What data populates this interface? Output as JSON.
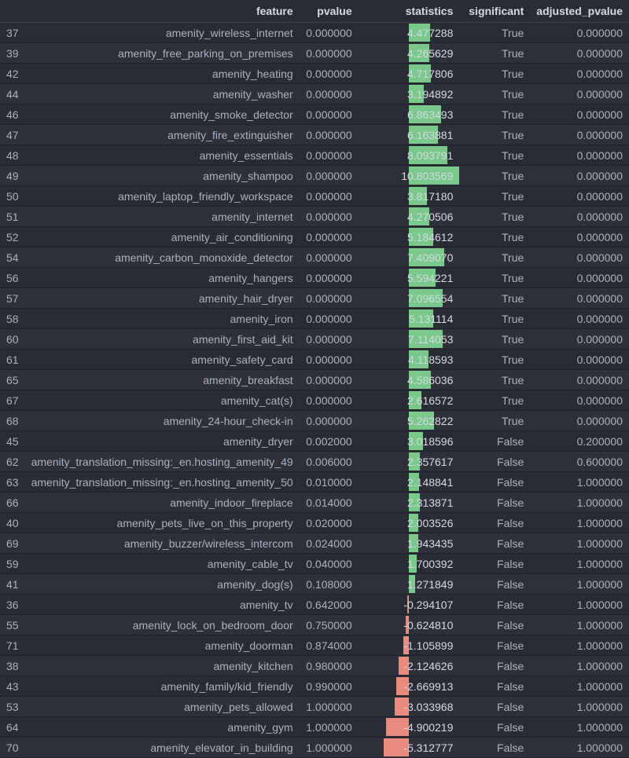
{
  "columns": {
    "idx": "",
    "feature": "feature",
    "pvalue": "pvalue",
    "statistics": "statistics",
    "significant": "significant",
    "adjusted_pvalue": "adjusted_pvalue"
  },
  "chart_data": {
    "type": "table",
    "title": "",
    "stat_range": [
      -10.803569,
      10.803569
    ],
    "rows": [
      {
        "idx": 37,
        "feature": "amenity_wireless_internet",
        "pvalue": "0.000000",
        "statistics": 4.477288,
        "significant": "True",
        "adjusted_pvalue": "0.000000"
      },
      {
        "idx": 39,
        "feature": "amenity_free_parking_on_premises",
        "pvalue": "0.000000",
        "statistics": 4.265629,
        "significant": "True",
        "adjusted_pvalue": "0.000000"
      },
      {
        "idx": 42,
        "feature": "amenity_heating",
        "pvalue": "0.000000",
        "statistics": 4.717806,
        "significant": "True",
        "adjusted_pvalue": "0.000000"
      },
      {
        "idx": 44,
        "feature": "amenity_washer",
        "pvalue": "0.000000",
        "statistics": 3.194892,
        "significant": "True",
        "adjusted_pvalue": "0.000000"
      },
      {
        "idx": 46,
        "feature": "amenity_smoke_detector",
        "pvalue": "0.000000",
        "statistics": 6.863493,
        "significant": "True",
        "adjusted_pvalue": "0.000000"
      },
      {
        "idx": 47,
        "feature": "amenity_fire_extinguisher",
        "pvalue": "0.000000",
        "statistics": 6.163881,
        "significant": "True",
        "adjusted_pvalue": "0.000000"
      },
      {
        "idx": 48,
        "feature": "amenity_essentials",
        "pvalue": "0.000000",
        "statistics": 8.093791,
        "significant": "True",
        "adjusted_pvalue": "0.000000"
      },
      {
        "idx": 49,
        "feature": "amenity_shampoo",
        "pvalue": "0.000000",
        "statistics": 10.803569,
        "significant": "True",
        "adjusted_pvalue": "0.000000"
      },
      {
        "idx": 50,
        "feature": "amenity_laptop_friendly_workspace",
        "pvalue": "0.000000",
        "statistics": 3.81718,
        "significant": "True",
        "adjusted_pvalue": "0.000000"
      },
      {
        "idx": 51,
        "feature": "amenity_internet",
        "pvalue": "0.000000",
        "statistics": 4.270506,
        "significant": "True",
        "adjusted_pvalue": "0.000000"
      },
      {
        "idx": 52,
        "feature": "amenity_air_conditioning",
        "pvalue": "0.000000",
        "statistics": 5.184612,
        "significant": "True",
        "adjusted_pvalue": "0.000000"
      },
      {
        "idx": 54,
        "feature": "amenity_carbon_monoxide_detector",
        "pvalue": "0.000000",
        "statistics": 7.40907,
        "significant": "True",
        "adjusted_pvalue": "0.000000"
      },
      {
        "idx": 56,
        "feature": "amenity_hangers",
        "pvalue": "0.000000",
        "statistics": 5.594221,
        "significant": "True",
        "adjusted_pvalue": "0.000000"
      },
      {
        "idx": 57,
        "feature": "amenity_hair_dryer",
        "pvalue": "0.000000",
        "statistics": 7.096554,
        "significant": "True",
        "adjusted_pvalue": "0.000000"
      },
      {
        "idx": 58,
        "feature": "amenity_iron",
        "pvalue": "0.000000",
        "statistics": 5.131114,
        "significant": "True",
        "adjusted_pvalue": "0.000000"
      },
      {
        "idx": 60,
        "feature": "amenity_first_aid_kit",
        "pvalue": "0.000000",
        "statistics": 7.114053,
        "significant": "True",
        "adjusted_pvalue": "0.000000"
      },
      {
        "idx": 61,
        "feature": "amenity_safety_card",
        "pvalue": "0.000000",
        "statistics": 4.118593,
        "significant": "True",
        "adjusted_pvalue": "0.000000"
      },
      {
        "idx": 65,
        "feature": "amenity_breakfast",
        "pvalue": "0.000000",
        "statistics": 4.586036,
        "significant": "True",
        "adjusted_pvalue": "0.000000"
      },
      {
        "idx": 67,
        "feature": "amenity_cat(s)",
        "pvalue": "0.000000",
        "statistics": 2.616572,
        "significant": "True",
        "adjusted_pvalue": "0.000000"
      },
      {
        "idx": 68,
        "feature": "amenity_24-hour_check-in",
        "pvalue": "0.000000",
        "statistics": 5.262822,
        "significant": "True",
        "adjusted_pvalue": "0.000000"
      },
      {
        "idx": 45,
        "feature": "amenity_dryer",
        "pvalue": "0.002000",
        "statistics": 3.018596,
        "significant": "False",
        "adjusted_pvalue": "0.200000"
      },
      {
        "idx": 62,
        "feature": "amenity_translation_missing:_en.hosting_amenity_49",
        "pvalue": "0.006000",
        "statistics": 2.357617,
        "significant": "False",
        "adjusted_pvalue": "0.600000"
      },
      {
        "idx": 63,
        "feature": "amenity_translation_missing:_en.hosting_amenity_50",
        "pvalue": "0.010000",
        "statistics": 2.148841,
        "significant": "False",
        "adjusted_pvalue": "1.000000"
      },
      {
        "idx": 66,
        "feature": "amenity_indoor_fireplace",
        "pvalue": "0.014000",
        "statistics": 2.313871,
        "significant": "False",
        "adjusted_pvalue": "1.000000"
      },
      {
        "idx": 40,
        "feature": "amenity_pets_live_on_this_property",
        "pvalue": "0.020000",
        "statistics": 2.003526,
        "significant": "False",
        "adjusted_pvalue": "1.000000"
      },
      {
        "idx": 69,
        "feature": "amenity_buzzer/wireless_intercom",
        "pvalue": "0.024000",
        "statistics": 1.943435,
        "significant": "False",
        "adjusted_pvalue": "1.000000"
      },
      {
        "idx": 59,
        "feature": "amenity_cable_tv",
        "pvalue": "0.040000",
        "statistics": 1.700392,
        "significant": "False",
        "adjusted_pvalue": "1.000000"
      },
      {
        "idx": 41,
        "feature": "amenity_dog(s)",
        "pvalue": "0.108000",
        "statistics": 1.271849,
        "significant": "False",
        "adjusted_pvalue": "1.000000"
      },
      {
        "idx": 36,
        "feature": "amenity_tv",
        "pvalue": "0.642000",
        "statistics": -0.294107,
        "significant": "False",
        "adjusted_pvalue": "1.000000"
      },
      {
        "idx": 55,
        "feature": "amenity_lock_on_bedroom_door",
        "pvalue": "0.750000",
        "statistics": -0.62481,
        "significant": "False",
        "adjusted_pvalue": "1.000000"
      },
      {
        "idx": 71,
        "feature": "amenity_doorman",
        "pvalue": "0.874000",
        "statistics": -1.105899,
        "significant": "False",
        "adjusted_pvalue": "1.000000"
      },
      {
        "idx": 38,
        "feature": "amenity_kitchen",
        "pvalue": "0.980000",
        "statistics": -2.124626,
        "significant": "False",
        "adjusted_pvalue": "1.000000"
      },
      {
        "idx": 43,
        "feature": "amenity_family/kid_friendly",
        "pvalue": "0.990000",
        "statistics": -2.669913,
        "significant": "False",
        "adjusted_pvalue": "1.000000"
      },
      {
        "idx": 53,
        "feature": "amenity_pets_allowed",
        "pvalue": "1.000000",
        "statistics": -3.033968,
        "significant": "False",
        "adjusted_pvalue": "1.000000"
      },
      {
        "idx": 64,
        "feature": "amenity_gym",
        "pvalue": "1.000000",
        "statistics": -4.900219,
        "significant": "False",
        "adjusted_pvalue": "1.000000"
      },
      {
        "idx": 70,
        "feature": "amenity_elevator_in_building",
        "pvalue": "1.000000",
        "statistics": -5.312777,
        "significant": "False",
        "adjusted_pvalue": "1.000000"
      }
    ]
  }
}
